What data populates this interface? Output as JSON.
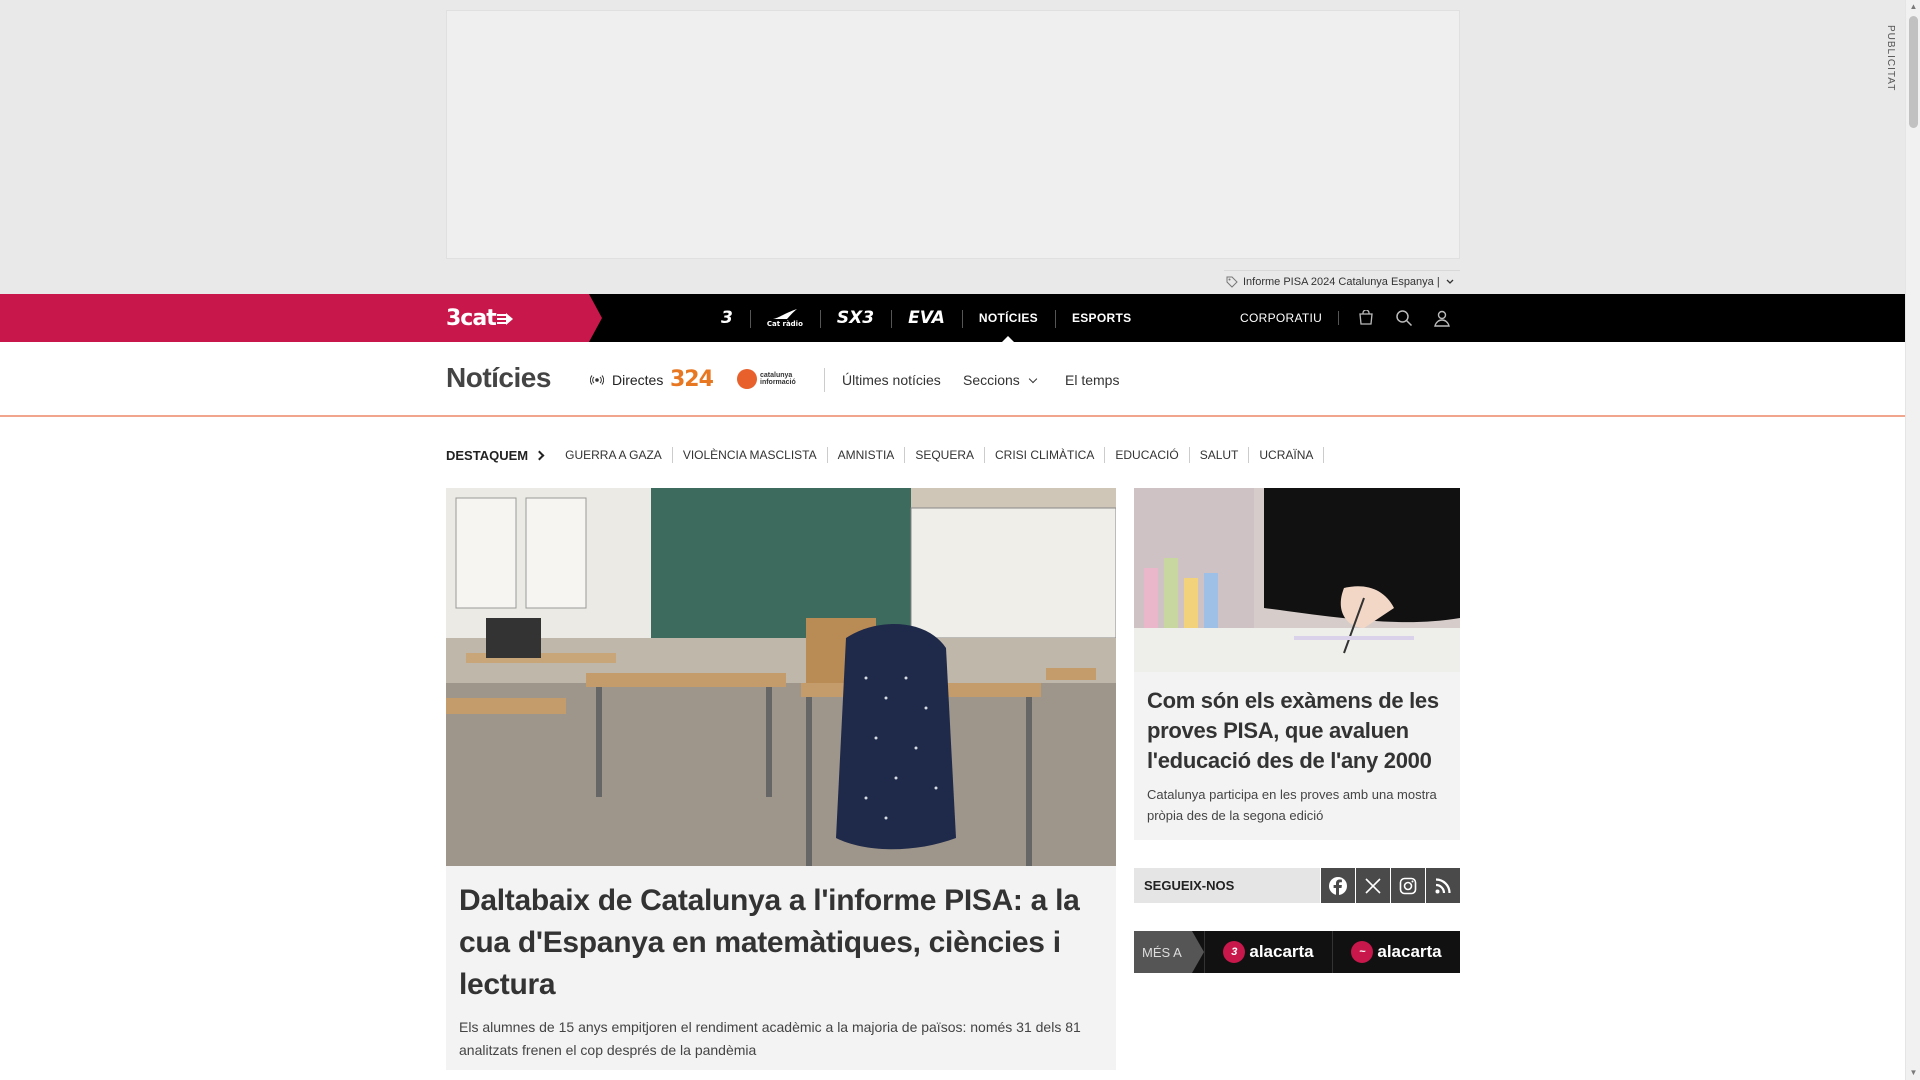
{
  "ad": {
    "label": "PUBLICITAT"
  },
  "topic_bar": {
    "text": "Informe PISA 2024 Catalunya Espanya |"
  },
  "nav": {
    "logo": "3cat",
    "channels": [
      "3",
      "Cat ràdio",
      "SX3",
      "EVA"
    ],
    "sections": [
      "NOTÍCIES",
      "ESPORTS"
    ],
    "corporate": "CORPORATIU"
  },
  "section": {
    "title": "Notícies",
    "directes": "Directes",
    "logo_324": "324",
    "logo_catinfo": "catalunya informació",
    "links": [
      "Últimes notícies",
      "Seccions",
      "El temps"
    ]
  },
  "highlights": {
    "lead": "DESTAQUEM",
    "items": [
      "GUERRA A GAZA",
      "VIOLÈNCIA MASCLISTA",
      "AMNISTIA",
      "SEQUERA",
      "CRISI CLIMÀTICA",
      "EDUCACIÓ",
      "SALUT",
      "UCRAÏNA"
    ]
  },
  "main_article": {
    "title": "Daltabaix de Catalunya a l'informe PISA: a la cua d'Espanya en matemàtiques, ciències i lectura",
    "summary": "Els alumnes de 15 anys empitjoren el rendiment acadèmic a la majoria de països: només 31 dels 81 analitzats frenen el cop després de la pandèmia"
  },
  "side_article": {
    "title": "Com són els exàmens de les proves PISA, que avaluen l'educació des de l'any 2000",
    "summary": "Catalunya participa en les proves amb una mostra pròpia des de la segona edició"
  },
  "follow": {
    "label": "SEGUEIX-NOS",
    "networks": [
      "facebook-icon",
      "x-icon",
      "instagram-icon",
      "rss-icon"
    ]
  },
  "mes_a": {
    "label": "MÉS A",
    "items": [
      "3 alacarta",
      "alacarta"
    ],
    "item_text": "alacarta",
    "badge_3": "3"
  },
  "colors": {
    "brand": "#c8174a",
    "nav_bg": "#000000",
    "accent_324": "#e87722"
  }
}
